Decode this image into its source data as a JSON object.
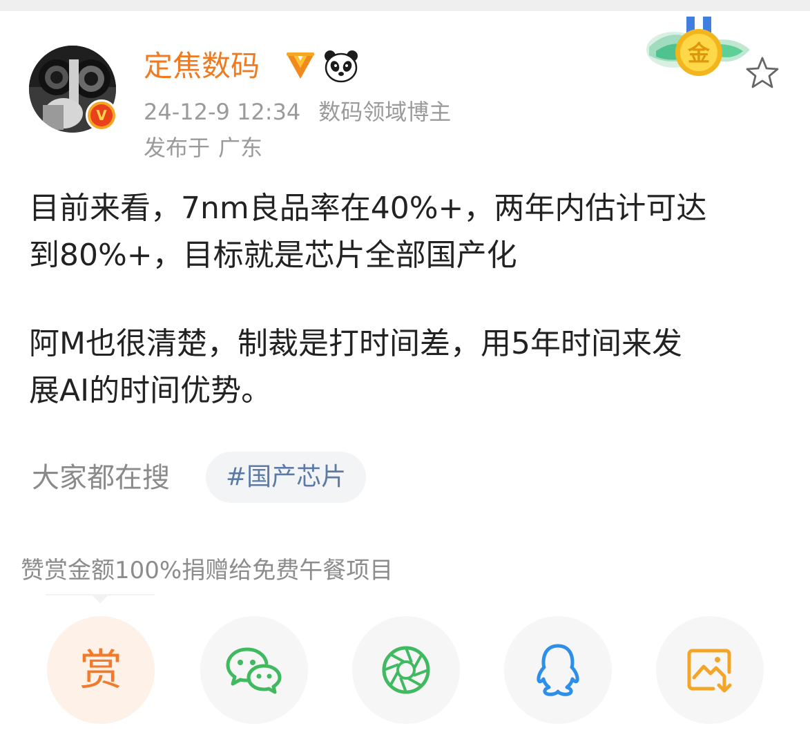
{
  "user": {
    "name": "定焦数码",
    "datetime": "24-12-9 12:34",
    "role": "数码领域博主",
    "location_prefix": "发布于",
    "location": "广东",
    "verified_badge": "V"
  },
  "medal": {
    "label": "金"
  },
  "post": {
    "paragraphs": [
      "目前来看，7nm良品率在40%+，两年内估计可达\n到80%+，目标就是芯片全部国产化",
      "阿M也很清楚，制裁是打时间差，用5年时间来发\n展AI的时间优势。"
    ]
  },
  "search": {
    "label": "大家都在搜",
    "topic": "#国产芯片"
  },
  "reward": {
    "note": "赞赏金额100%捐赠给免费午餐项目",
    "button_label": "赏"
  },
  "share_buttons": [
    {
      "id": "reward",
      "icon": "reward-icon",
      "color": "#f27a2a"
    },
    {
      "id": "wechat",
      "icon": "wechat-icon",
      "color": "#41b960"
    },
    {
      "id": "moments",
      "icon": "moments-icon",
      "color": "#41b960"
    },
    {
      "id": "qq",
      "icon": "qq-icon",
      "color": "#2d8fe8"
    },
    {
      "id": "save-image",
      "icon": "save-image-icon",
      "color": "#f2a526"
    }
  ],
  "colors": {
    "username": "#ef7a1f",
    "meta_text": "#9a9a9a",
    "body_text": "#222222",
    "topic_link": "#5c7aa6"
  }
}
